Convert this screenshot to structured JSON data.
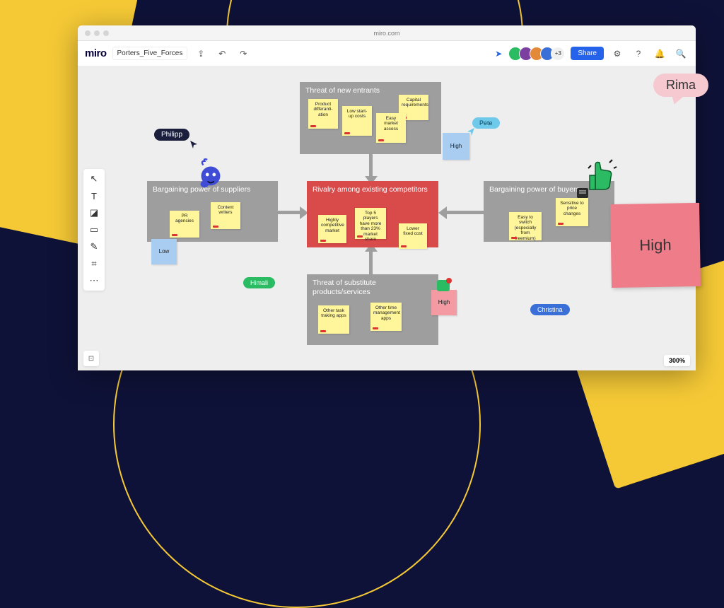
{
  "browser": {
    "url": "miro.com"
  },
  "header": {
    "logo": "miro",
    "board_name": "Porters_Five_Forces",
    "avatar_colors": [
      "#2bbb62",
      "#7b3fa0",
      "#e2893a",
      "#3a6fd8"
    ],
    "extra_count": "+3",
    "share_label": "Share"
  },
  "forces": {
    "new_entrants": {
      "title": "Threat of new entrants",
      "notes": [
        "Product differanti-ation",
        "Low start-up costs",
        "Capital requirements",
        "Easy market access"
      ],
      "rating": "High"
    },
    "suppliers": {
      "title": "Bargaining power of suppliers",
      "notes": [
        "PR agencies",
        "Content writers"
      ],
      "rating": "Low"
    },
    "rivalry": {
      "title": "Rivalry among existing competitors",
      "notes": [
        "Highly competitive market",
        "Top 5 players have more than 23% market share",
        "Lower fixed cost"
      ]
    },
    "buyers": {
      "title": "Bargaining power of buyers",
      "notes": [
        "Easy to switch (especially from freemium)",
        "Sensitive to price changes"
      ],
      "rating": "High"
    },
    "substitutes": {
      "title": "Threat of substitute products/services",
      "notes": [
        "Other task traking apps",
        "Other time management apps"
      ],
      "rating": "High"
    }
  },
  "users": {
    "philipp": {
      "name": "Philipp",
      "color": "#1b1f3b"
    },
    "himali": {
      "name": "Himali",
      "color": "#2bbb62"
    },
    "pete": {
      "name": "Pete",
      "color": "#6fc9ea"
    },
    "christina": {
      "name": "Christina",
      "color": "#3a6fd8"
    },
    "rima": {
      "name": "Rima"
    }
  },
  "zoom": "300%"
}
